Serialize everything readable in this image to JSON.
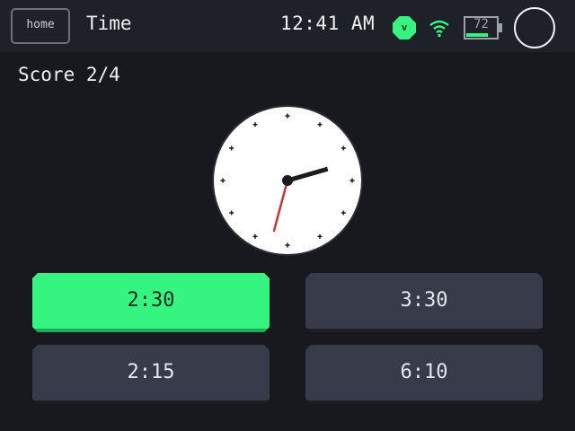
{
  "header": {
    "home_label": "home",
    "title": "Time",
    "time": "12:41 AM",
    "badge_letter": "v",
    "battery_percent": 72,
    "battery_label": "72",
    "accent_color": "#35f47f"
  },
  "score_text": "Score 2/4",
  "question_clock": {
    "hour_hand_minutes": 148,
    "minute_hand_minutes": 32.5,
    "icons": [
      "clock-face-icon"
    ]
  },
  "answers": [
    {
      "label": "2:30",
      "selected": true
    },
    {
      "label": "3:30",
      "selected": false
    },
    {
      "label": "2:15",
      "selected": false
    },
    {
      "label": "6:10",
      "selected": false
    }
  ],
  "icons": {
    "wifi": "wifi-icon",
    "battery": "battery-icon",
    "power": "power-circle-icon"
  }
}
